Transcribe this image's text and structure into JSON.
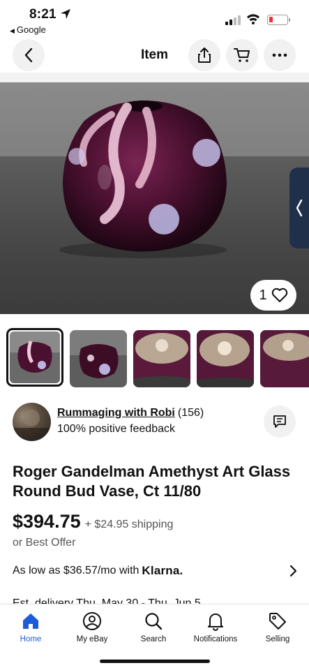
{
  "status_bar": {
    "time": "8:21",
    "back_app": "Google"
  },
  "nav": {
    "title": "Item",
    "back_icon": "chevron-left-icon",
    "share_icon": "share-icon",
    "cart_icon": "cart-icon",
    "more_icon": "more-icon"
  },
  "hero": {
    "like_count": "1",
    "side_tab_icon": "chevron-left-icon"
  },
  "thumbnails": {
    "selected_index": 0,
    "count_visible": 5
  },
  "seller": {
    "name": "Rummaging with Robi",
    "rating_count": "(156)",
    "feedback": "100% positive feedback"
  },
  "listing": {
    "title": "Roger Gandelman Amethyst Art Glass Round Bud Vase, Ct 11/80",
    "price": "$394.75",
    "shipping": "+ $24.95 shipping",
    "best_offer": "or Best Offer",
    "klarna_text": "As low as $36.57/mo with",
    "klarna_brand": "Klarna.",
    "delivery_peek": "Est. delivery Thu, May 30 - Thu, Jun 5"
  },
  "tab_bar": {
    "tabs": [
      {
        "label": "Home",
        "icon": "home-icon",
        "active": true
      },
      {
        "label": "My eBay",
        "icon": "user-icon",
        "active": false
      },
      {
        "label": "Search",
        "icon": "search-icon",
        "active": false
      },
      {
        "label": "Notifications",
        "icon": "bell-icon",
        "active": false
      },
      {
        "label": "Selling",
        "icon": "tag-icon",
        "active": false
      }
    ]
  },
  "colors": {
    "accent": "#1e5bd8",
    "vase": "#4a1030",
    "battery_low": "#e33333"
  }
}
